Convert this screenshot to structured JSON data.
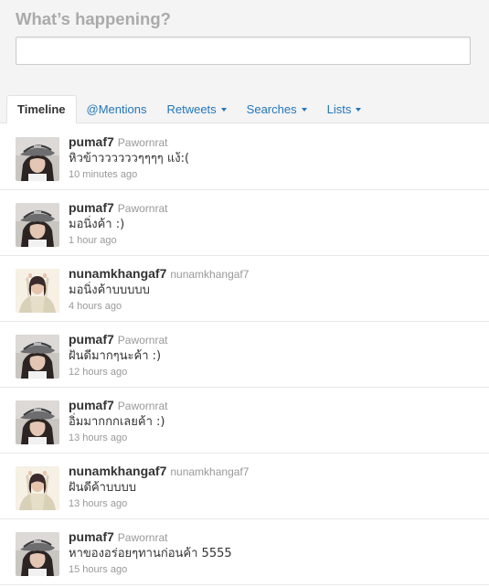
{
  "composer": {
    "prompt": "What’s happening?",
    "value": ""
  },
  "tabs": [
    {
      "label": "Timeline",
      "active": true,
      "dropdown": false
    },
    {
      "label": "@Mentions",
      "active": false,
      "dropdown": false
    },
    {
      "label": "Retweets",
      "active": false,
      "dropdown": true
    },
    {
      "label": "Searches",
      "active": false,
      "dropdown": true
    },
    {
      "label": "Lists",
      "active": false,
      "dropdown": true
    }
  ],
  "tweets": [
    {
      "screen_name": "pumaf7",
      "full_name": "Pawornrat",
      "text": "หิวข้าววววววๆๆๆๆ แง้:(",
      "time": "10 minutes ago",
      "avatar": "cap-girl-avatar"
    },
    {
      "screen_name": "pumaf7",
      "full_name": "Pawornrat",
      "text": "มอนิ่งค้า :)",
      "time": "1 hour ago",
      "avatar": "cap-girl-avatar"
    },
    {
      "screen_name": "nunamkhangaf7",
      "full_name": "nunamkhangaf7",
      "text": "มอนิ่งค้าบบบบบ",
      "time": "4 hours ago",
      "avatar": "sweater-girl-avatar"
    },
    {
      "screen_name": "pumaf7",
      "full_name": "Pawornrat",
      "text": "ฝันดีมากๆนะค้า :)",
      "time": "12 hours ago",
      "avatar": "cap-girl-avatar"
    },
    {
      "screen_name": "pumaf7",
      "full_name": "Pawornrat",
      "text": "อิ่มมากกกเลยค้า :)",
      "time": "13 hours ago",
      "avatar": "cap-girl-avatar"
    },
    {
      "screen_name": "nunamkhangaf7",
      "full_name": "nunamkhangaf7",
      "text": "ฝันดีค้าบบบบ",
      "time": "13 hours ago",
      "avatar": "sweater-girl-avatar"
    },
    {
      "screen_name": "pumaf7",
      "full_name": "Pawornrat",
      "text": "หาของอร่อยๆทานก่อนค้า 5555",
      "time": "15 hours ago",
      "avatar": "cap-girl-avatar"
    }
  ]
}
